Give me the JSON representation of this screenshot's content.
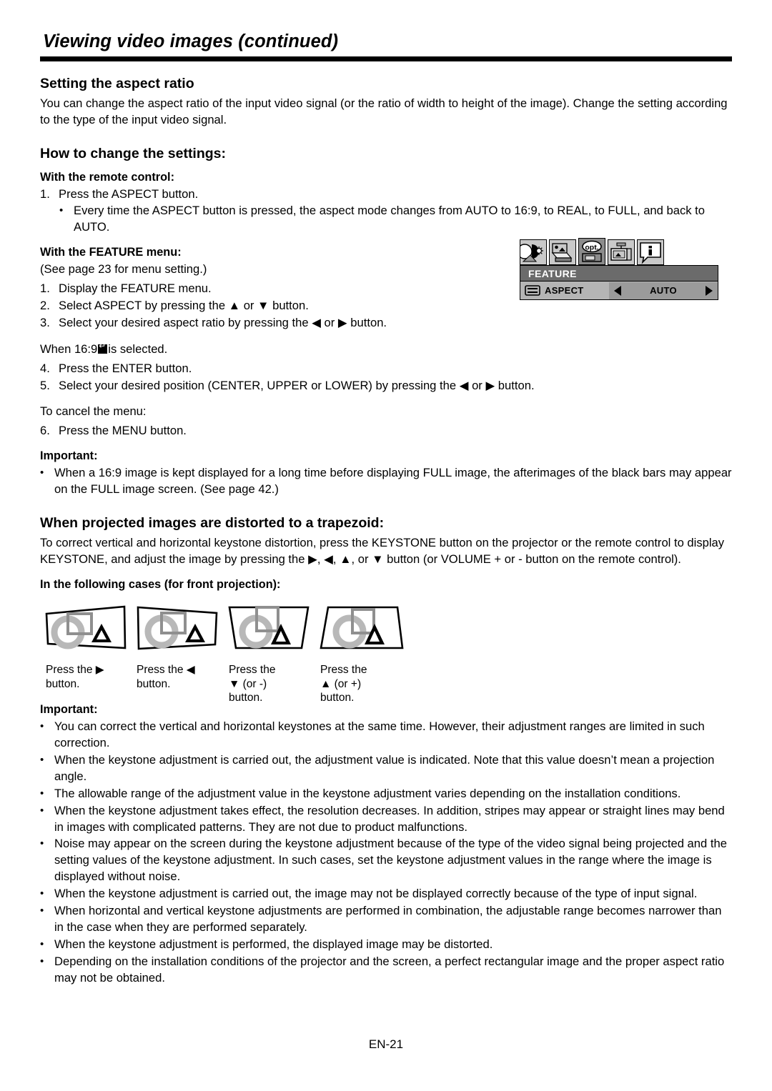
{
  "header": {
    "title": "Viewing video images (continued)"
  },
  "section_aspect": {
    "heading": "Setting the aspect ratio",
    "intro": "You can change the aspect ratio of the input video signal (or the ratio of width to height of the image). Change the setting according to the type of the input video signal.",
    "howto_heading": "How to change the settings:",
    "remote_lead": "With the remote control:",
    "remote_steps": [
      {
        "num": "1.",
        "text": "Press the ASPECT button."
      }
    ],
    "remote_bullets": [
      "Every time the ASPECT button is pressed, the aspect mode changes from AUTO to 16:9, to REAL, to FULL, and back to AUTO."
    ],
    "feature_lead": "With the FEATURE menu:",
    "feature_note": "(See page 23 for menu setting.)",
    "feature_steps": [
      {
        "num": "1.",
        "text": "Display the FEATURE menu."
      },
      {
        "num": "2.",
        "text": "Select ASPECT by pressing the ▲ or ▼ button."
      },
      {
        "num": "3.",
        "text": "Select your desired aspect ratio by pressing the ◀ or ▶ button."
      }
    ],
    "when_169_prefix": "When 16:9",
    "when_169_suffix": "is selected.",
    "steps_169": [
      {
        "num": "4.",
        "text": "Press the ENTER button."
      },
      {
        "num": "5.",
        "text": "Select your desired position (CENTER, UPPER or LOWER) by pressing the ◀ or ▶ button."
      }
    ],
    "cancel_note": "To cancel the menu:",
    "cancel_steps": [
      {
        "num": "6.",
        "text": "Press the MENU button."
      }
    ],
    "important_label": "Important:",
    "important_bullets": [
      "When a 16:9 image is kept displayed for a long time before displaying FULL image, the afterimages of the black bars may appear on the FULL image screen. (See page 42.)"
    ]
  },
  "osd": {
    "tabs": [
      {
        "name": "image-tab",
        "label": "image"
      },
      {
        "name": "installation-tab",
        "label": "installation"
      },
      {
        "name": "feature-tab",
        "label": "opt."
      },
      {
        "name": "signal-tab",
        "label": "signal"
      },
      {
        "name": "information-tab",
        "label": "i"
      }
    ],
    "selected_tab_index": 2,
    "title": "FEATURE",
    "rows": [
      {
        "label": "ASPECT",
        "value": "AUTO",
        "left_arrow": "◀",
        "right_arrow": "▶"
      }
    ]
  },
  "section_trapezoid": {
    "heading": "When projected images are distorted to a trapezoid:",
    "intro": "To correct vertical and horizontal keystone distortion, press the KEYSTONE button on the projector or the remote control to display KEYSTONE, and adjust the image by pressing the ▶, ◀, ▲, or ▼ button (or VOLUME + or - button on the remote control).",
    "cases_lead": "In the following cases (for front projection):",
    "diagrams": [
      {
        "name": "keystone-right",
        "label_line1": "Press the ▶",
        "label_line2": "button.",
        "label_line3": ""
      },
      {
        "name": "keystone-left",
        "label_line1": "Press the ◀",
        "label_line2": "button.",
        "label_line3": ""
      },
      {
        "name": "keystone-down",
        "label_line1": "Press the",
        "label_line2": "▼ (or -)",
        "label_line3": "button."
      },
      {
        "name": "keystone-up",
        "label_line1": "Press the",
        "label_line2": "▲ (or +)",
        "label_line3": "button."
      }
    ],
    "important_label": "Important:",
    "important_bullets": [
      "You can correct the vertical and horizontal keystones at the same time. However, their adjustment ranges are limited in such correction.",
      "When the keystone adjustment is carried out, the adjustment value is indicated. Note that this value doesn’t mean a projection angle.",
      "The allowable range of the adjustment value in the keystone adjustment varies depending on the installation conditions.",
      "When the keystone adjustment takes effect, the resolution decreases. In addition, stripes may appear or straight lines may bend in images with complicated patterns. They are not due to product malfunctions.",
      "Noise may appear on the screen during the keystone adjustment because of the type of the video signal being projected and the setting values of the keystone adjustment. In such cases, set the keystone adjustment values in the range where the image is displayed without noise.",
      "When the keystone adjustment is carried out, the image may not be displayed correctly because of the type of input signal.",
      "When horizontal and vertical keystone adjustments are performed in combination, the adjustable range becomes narrower than in the case when they are performed separately.",
      "When the keystone adjustment is performed, the displayed image may be distorted.",
      "Depending on the installation conditions of the projector and the screen, a perfect rectangular image and the proper aspect ratio may not be obtained."
    ]
  },
  "footer": {
    "page_number": "EN-21"
  },
  "bullet_char": "•",
  "colors": {
    "text": "#000000",
    "rule": "#000000",
    "osd_titlebar": "#6b6b6b",
    "osd_row": "#b5b5b5",
    "osd_value": "#9b9b9b",
    "osd_tab": "#c9c9c9",
    "osd_tab_selected": "#8c8c8c",
    "diagram_gray": "#b0b0b0",
    "diagram_dark_gray": "#7a7a7a"
  }
}
